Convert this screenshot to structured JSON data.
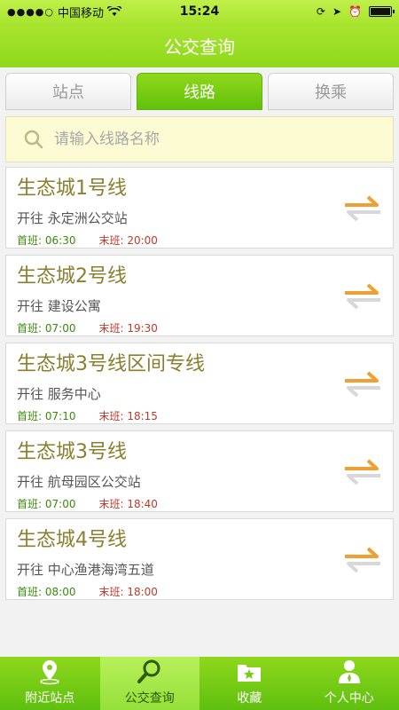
{
  "status_bar": {
    "carrier": "中国移动",
    "time": "15:24"
  },
  "nav": {
    "title": "公交查询"
  },
  "tabs": [
    {
      "label": "站点",
      "active": false
    },
    {
      "label": "线路",
      "active": true
    },
    {
      "label": "换乘",
      "active": false
    }
  ],
  "search": {
    "placeholder": "请输入线路名称",
    "value": ""
  },
  "routes": [
    {
      "name": "生态城1号线",
      "dest": "开往 永定洲公交站",
      "first_label": "首班:",
      "first_time": "06:30",
      "last_label": "末班:",
      "last_time": "20:00"
    },
    {
      "name": "生态城2号线",
      "dest": "开往 建设公寓",
      "first_label": "首班:",
      "first_time": "07:00",
      "last_label": "末班:",
      "last_time": "19:30"
    },
    {
      "name": "生态城3号线区间专线",
      "dest": "开往 服务中心",
      "first_label": "首班:",
      "first_time": "07:10",
      "last_label": "末班:",
      "last_time": "18:15"
    },
    {
      "name": "生态城3号线",
      "dest": "开往 航母园区公交站",
      "first_label": "首班:",
      "first_time": "07:00",
      "last_label": "末班:",
      "last_time": "18:40"
    },
    {
      "name": "生态城4号线",
      "dest": "开往 中心渔港海湾五道",
      "first_label": "首班:",
      "first_time": "08:00",
      "last_label": "末班:",
      "last_time": "18:00"
    }
  ],
  "tab_bar": [
    {
      "label": "附近站点",
      "icon": "location-pin-icon",
      "active": false
    },
    {
      "label": "公交查询",
      "icon": "magnifier-icon",
      "active": true
    },
    {
      "label": "收藏",
      "icon": "star-folder-icon",
      "active": false
    },
    {
      "label": "个人中心",
      "icon": "person-icon",
      "active": false
    }
  ],
  "colors": {
    "accent": "#8fd81c",
    "search_bg": "#fdfbd3",
    "route_name": "#8a7f2e",
    "first_time": "#3a8a0a",
    "last_time": "#c0392b",
    "swap_arrow": "#f0a030"
  }
}
